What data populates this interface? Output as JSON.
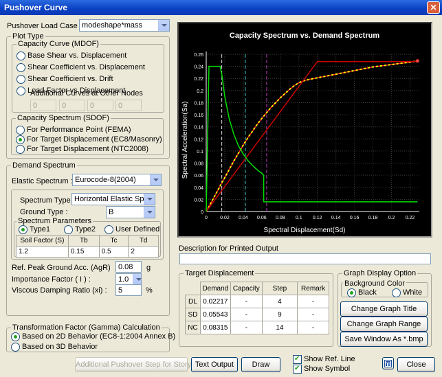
{
  "window": {
    "title": "Pushover Curve",
    "close_glyph": "✕"
  },
  "load_case": {
    "label": "Pushover Load Case",
    "value": "modeshape*mass"
  },
  "plot_type": {
    "label": "Plot Type",
    "mdof": {
      "label": "Capacity Curve (MDOF)",
      "options": [
        "Base Shear vs. Displacement",
        "Shear Coefficient vs. Displacement",
        "Shear Coefficient vs. Drift",
        "Load Factor vs Displacement"
      ],
      "additional_label": "Additional Curves at Other Nodes",
      "additional_values": [
        "0",
        "0",
        "0",
        "0"
      ]
    },
    "sdof": {
      "label": "Capacity Spectrum (SDOF)",
      "options": [
        "For Performance Point (FEMA)",
        "For Target Displacement (EC8/Masonry)",
        "For Target Displacement (NTC2008)"
      ],
      "selected": 1
    }
  },
  "demand": {
    "label": "Demand Spectrum",
    "elastic_label": "Elastic Spectrum :",
    "elastic_value": "Eurocode-8(2004)",
    "spectrum_type_label": "Spectrum Type :",
    "spectrum_type_value": "Horizontal Elastic Spectrum",
    "ground_type_label": "Ground Type :",
    "ground_type_value": "B",
    "params_label": "Spectrum Parameters",
    "type_options": [
      "Type1",
      "Type2",
      "User Defined"
    ],
    "type_selected": 0,
    "params_headers": [
      "Soil Factor (S)",
      "Tb",
      "Tc",
      "Td"
    ],
    "params_values": [
      "1.2",
      "0.15",
      "0.5",
      "2"
    ],
    "agr_label": "Ref. Peak Ground Acc. (AgR)",
    "agr_value": "0.08",
    "agr_unit": "g",
    "importance_label": "Importance Factor ( I ) :",
    "importance_value": "1.0",
    "damping_label": "Viscous Damping Ratio (xi) :",
    "damping_value": "5",
    "damping_unit": "%"
  },
  "gamma": {
    "label": "Transformation Factor (Gamma) Calculation",
    "options": [
      "Based on 2D Behavior (EC8-1:2004  Annex B)",
      "Based on 3D Behavior"
    ],
    "selected": 0
  },
  "chart_data": {
    "type": "line",
    "title": "Capacity Spectrum vs. Demand Spectrum",
    "xlabel": "Spectral Displacement(Sd)",
    "ylabel": "Spectral Acceleration(Sa)",
    "xlim": [
      0,
      0.23
    ],
    "ylim": [
      0,
      0.26
    ],
    "xticks": [
      "0",
      "0.02",
      "0.04",
      "0.06",
      "0.08",
      "0.1",
      "0.12",
      "0.14",
      "0.16",
      "0.18",
      "0.2",
      "0.22"
    ],
    "yticks": [
      "0",
      "0.02",
      "0.04",
      "0.06",
      "0.08",
      "0.1",
      "0.12",
      "0.14",
      "0.16",
      "0.18",
      "0.2",
      "0.22",
      "0.24",
      "0.26"
    ],
    "grid": true,
    "background": "#000000",
    "series": [
      {
        "color": "#FF2020",
        "x": [
          0,
          0.005,
          0.01,
          0.015,
          0.02,
          0.025,
          0.03,
          0.035,
          0.04,
          0.045,
          0.05,
          0.055,
          0.06,
          0.065,
          0.07,
          0.075,
          0.08,
          0.085,
          0.09,
          0.095,
          0.1,
          0.105,
          0.11,
          0.12,
          0.13,
          0.14,
          0.15,
          0.16,
          0.17,
          0.18,
          0.19,
          0.2,
          0.21,
          0.22,
          0.228
        ],
        "y": [
          0,
          0.014,
          0.028,
          0.042,
          0.056,
          0.07,
          0.084,
          0.097,
          0.11,
          0.122,
          0.133,
          0.144,
          0.154,
          0.163,
          0.172,
          0.18,
          0.188,
          0.195,
          0.202,
          0.208,
          0.213,
          0.216,
          0.218,
          0.221,
          0.224,
          0.227,
          0.23,
          0.233,
          0.236,
          0.239,
          0.241,
          0.243,
          0.245,
          0.247,
          0.249
        ]
      },
      {
        "color": "#FFFF00",
        "dashed": true,
        "x": [
          0,
          0.005,
          0.01,
          0.015,
          0.02,
          0.025,
          0.03,
          0.035,
          0.04,
          0.045,
          0.05,
          0.055,
          0.06,
          0.065,
          0.07,
          0.075,
          0.08,
          0.085,
          0.09,
          0.095,
          0.1,
          0.105,
          0.11,
          0.12,
          0.13,
          0.14,
          0.15,
          0.16,
          0.17,
          0.18,
          0.19,
          0.2,
          0.21,
          0.22,
          0.228
        ],
        "y": [
          0,
          0.014,
          0.028,
          0.042,
          0.056,
          0.07,
          0.084,
          0.097,
          0.11,
          0.122,
          0.133,
          0.144,
          0.154,
          0.163,
          0.172,
          0.18,
          0.188,
          0.195,
          0.202,
          0.208,
          0.213,
          0.216,
          0.218,
          0.221,
          0.224,
          0.227,
          0.23,
          0.233,
          0.236,
          0.239,
          0.241,
          0.243,
          0.245,
          0.247,
          0.249
        ]
      },
      {
        "color": "#CC0000",
        "x": [
          0,
          0.12,
          0.228
        ],
        "y": [
          0,
          0.248,
          0.248
        ]
      },
      {
        "color": "#00E000",
        "x": [
          0,
          0.003,
          0.0075,
          0.015,
          0.017,
          0.02,
          0.025,
          0.03,
          0.035,
          0.04,
          0.045,
          0.05,
          0.055,
          0.06,
          0.062,
          0.062,
          0.08,
          0.12,
          0.16,
          0.2,
          0.228
        ],
        "y": [
          0,
          0.24,
          0.24,
          0.24,
          0.225,
          0.19,
          0.152,
          0.127,
          0.108,
          0.095,
          0.084,
          0.076,
          0.069,
          0.063,
          0.06,
          0.016,
          0.016,
          0.016,
          0.016,
          0.016,
          0.016
        ]
      }
    ],
    "vlines": [
      {
        "x": 0.0168,
        "color": "#E8D8E8"
      },
      {
        "x": 0.0422,
        "color": "#40D0D0"
      },
      {
        "x": 0.0653,
        "color": "#C040C0"
      }
    ]
  },
  "description": {
    "label": "Description for Printed Output",
    "value": ""
  },
  "target": {
    "label": "Target Displacement",
    "headers": [
      "",
      "Demand",
      "Capacity",
      "Step",
      "Remark"
    ],
    "rows": [
      [
        "DL",
        "0.02217",
        "-",
        "4",
        "-"
      ],
      [
        "SD",
        "0.05543",
        "-",
        "9",
        "-"
      ],
      [
        "NC",
        "0.08315",
        "-",
        "14",
        "-"
      ]
    ]
  },
  "graph_option": {
    "label": "Graph Display Option",
    "bg_label": "Background Color",
    "bg_options": [
      "Black",
      "White"
    ],
    "bg_selected": 0,
    "change_title": "Change Graph Title",
    "change_range": "Change Graph Range",
    "save_window": "Save Window As *.bmp"
  },
  "bottom": {
    "additional_step": "Additional Pushover Step for Story Drift",
    "text_output": "Text Output",
    "draw": "Draw",
    "show_ref": "Show Ref. Line",
    "show_symbol": "Show Symbol",
    "close": "Close"
  }
}
